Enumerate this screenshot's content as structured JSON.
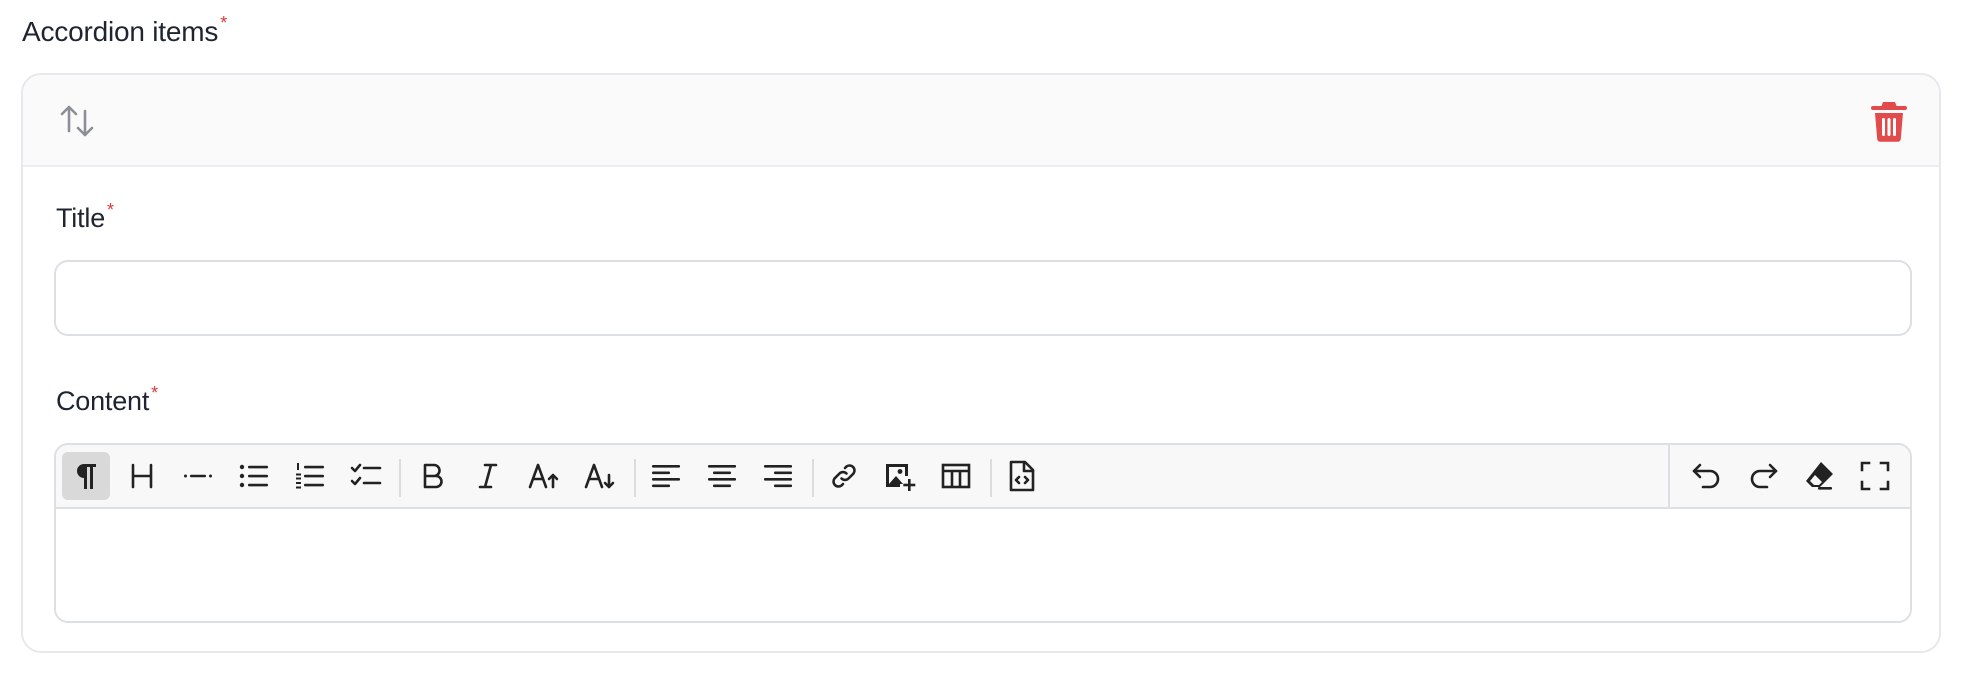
{
  "section": {
    "label": "Accordion items",
    "required_mark": "*"
  },
  "item": {
    "sort_icon": "arrows-up-down-icon",
    "delete_icon": "trash-icon",
    "delete_color": "#e24b4b",
    "title_field": {
      "label": "Title",
      "required_mark": "*",
      "value": "",
      "placeholder": ""
    },
    "content_field": {
      "label": "Content",
      "required_mark": "*",
      "value": "",
      "toolbar": {
        "left_groups": [
          [
            "paragraph-icon",
            "heading-icon",
            "horizontal-rule-icon",
            "bullet-list-icon",
            "ordered-list-icon",
            "task-list-icon"
          ],
          [
            "bold-icon",
            "italic-icon",
            "font-size-increase-icon",
            "font-size-decrease-icon"
          ],
          [
            "align-left-icon",
            "align-center-icon",
            "align-right-icon"
          ],
          [
            "link-icon",
            "insert-image-icon",
            "table-icon"
          ],
          [
            "source-code-icon"
          ]
        ],
        "right_group": [
          "undo-icon",
          "redo-icon",
          "clear-format-icon",
          "fullscreen-icon"
        ],
        "active": "paragraph-icon"
      }
    }
  },
  "colors": {
    "required": "#d93838",
    "text": "#1f2430",
    "icon": "#222222",
    "muted_icon": "#8c8f96"
  }
}
